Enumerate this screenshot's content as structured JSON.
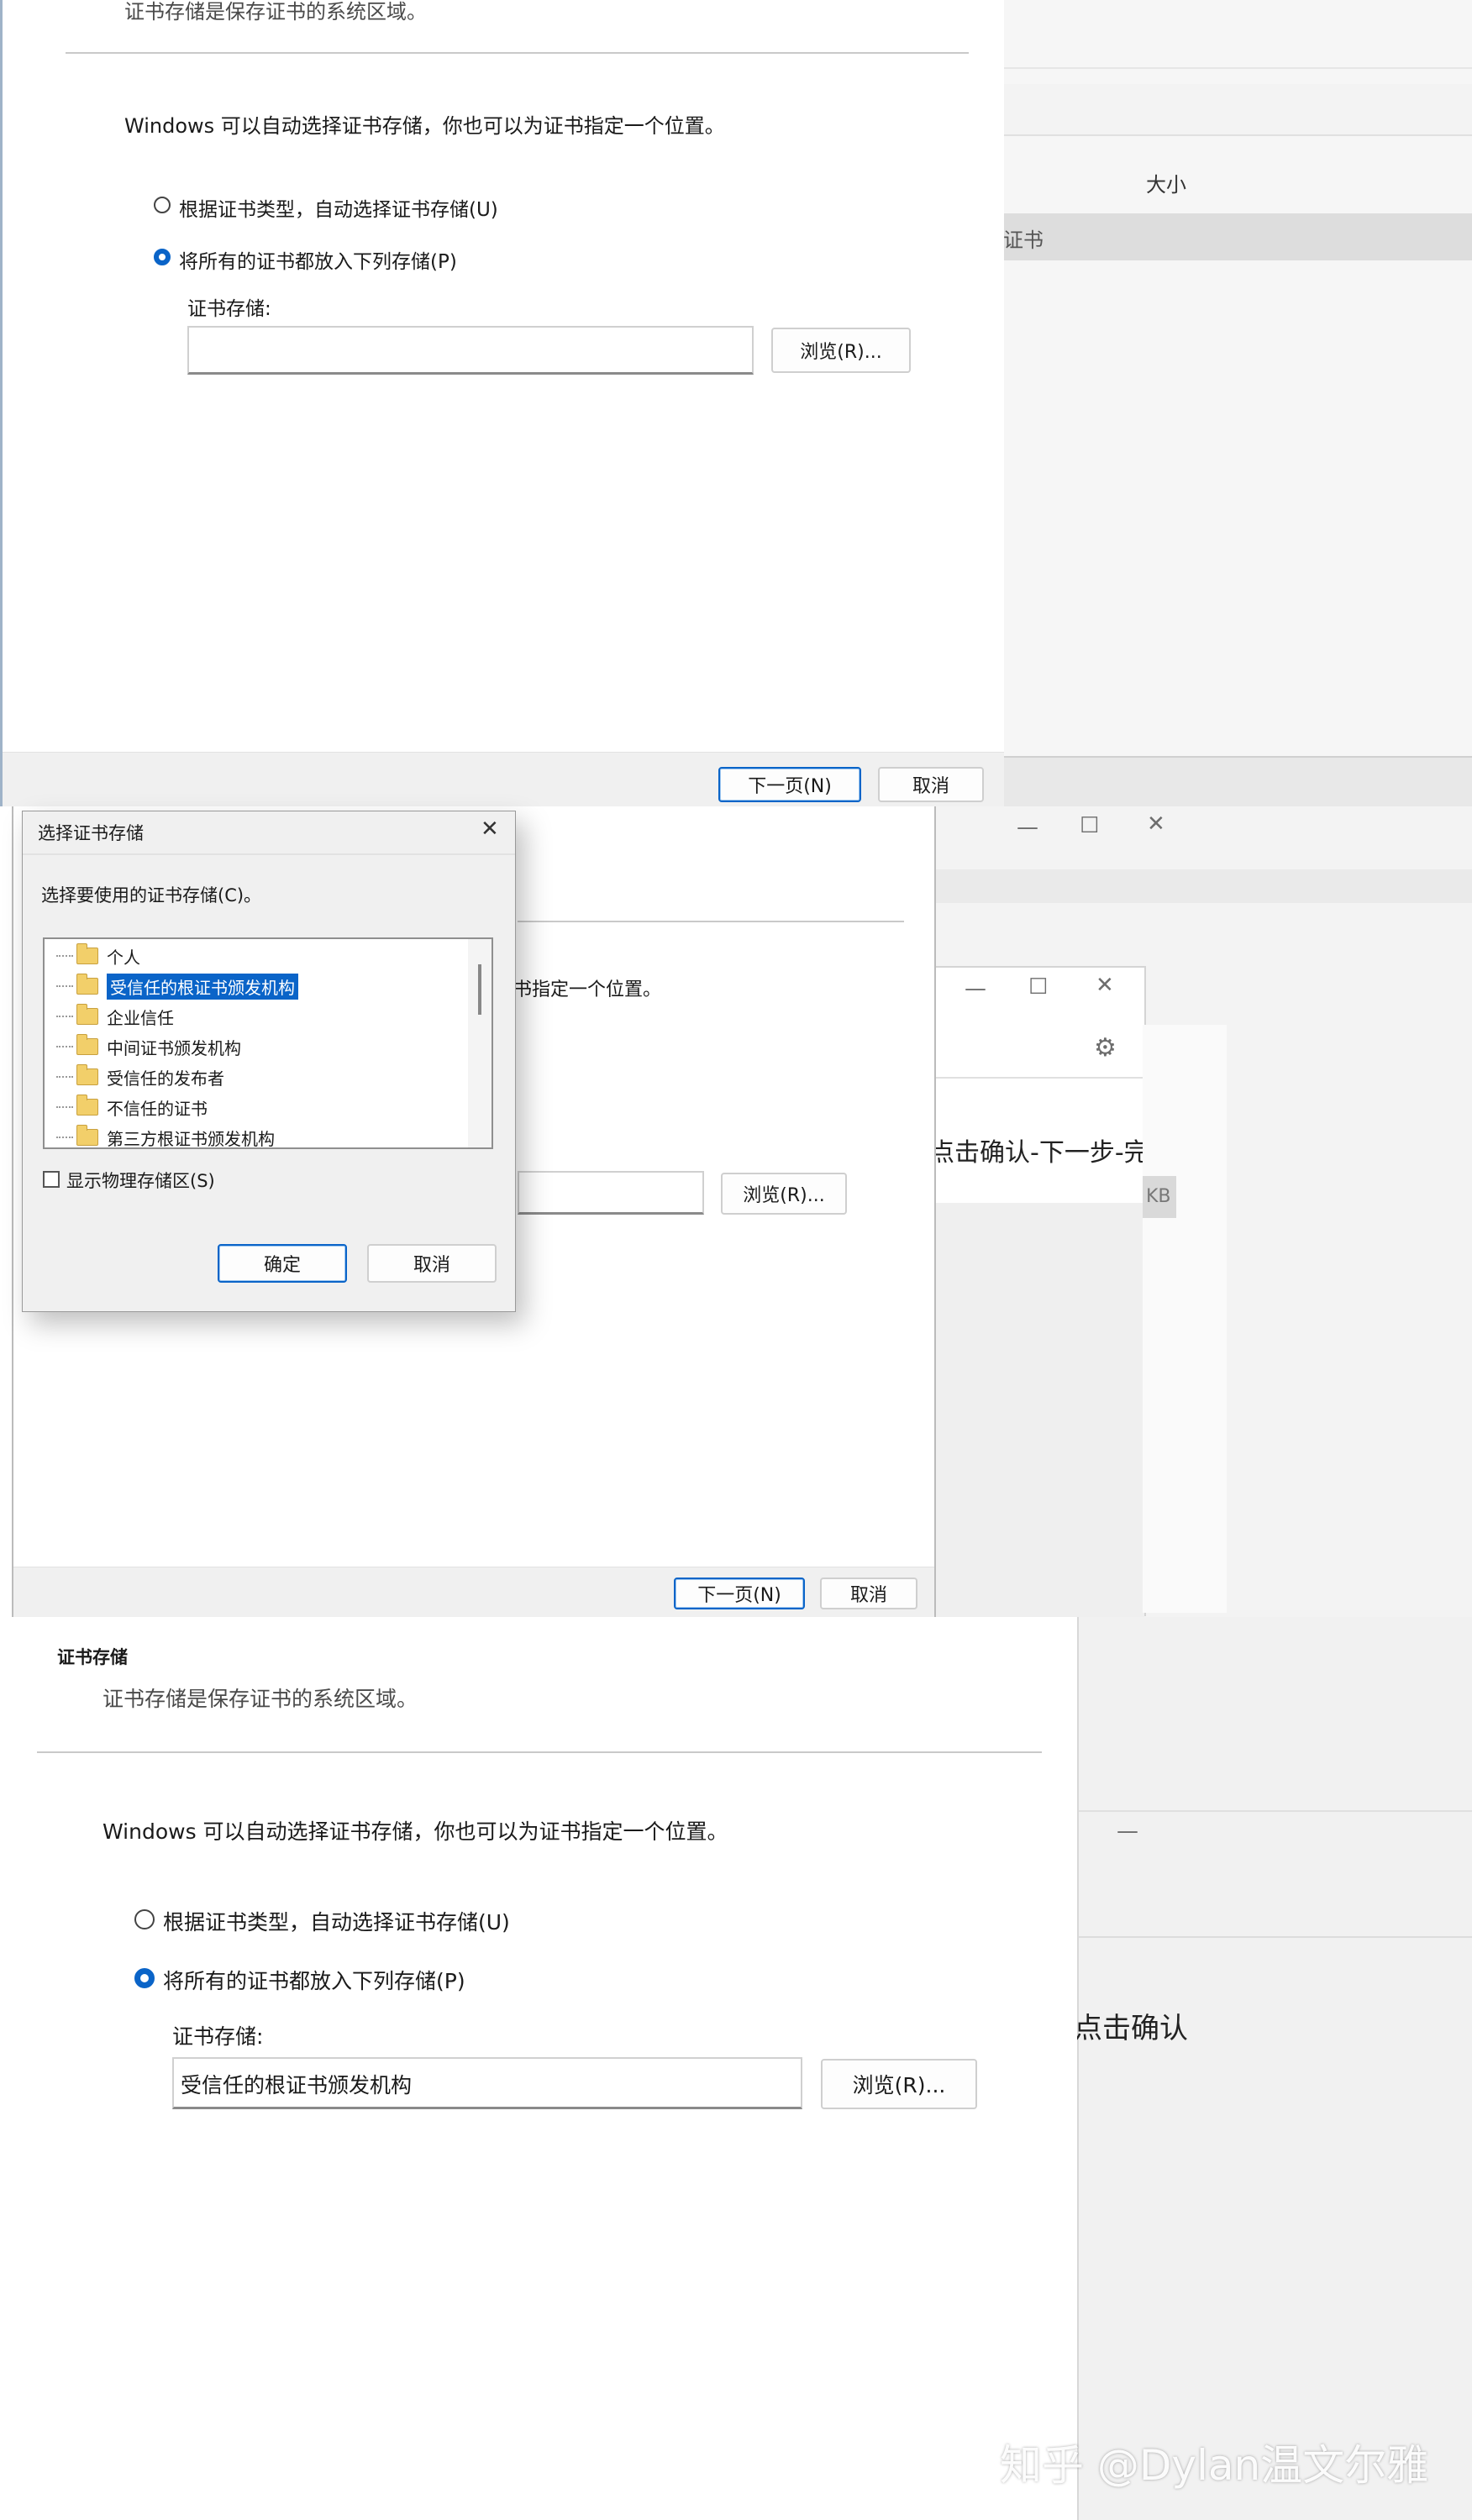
{
  "panel1": {
    "header_desc": "证书存储是保存证书的系统区域。",
    "intro": "Windows 可以自动选择证书存储，你也可以为证书指定一个位置。",
    "radio_auto": "根据证书类型，自动选择证书存储(U)",
    "radio_manual": "将所有的证书都放入下列存储(P)",
    "store_label": "证书存储:",
    "store_value": "",
    "browse": "浏览(R)...",
    "next": "下一页(N)",
    "cancel": "取消"
  },
  "panel1_right": {
    "col_header": "大小",
    "row_text": "证书"
  },
  "panel2": {
    "intro_partial": "书指定一个位置。",
    "browse": "浏览(R)...",
    "next": "下一页(N)",
    "cancel": "取消",
    "right_text": "点击确认-下一步-完成",
    "kb": "KB"
  },
  "select_dialog": {
    "title": "选择证书存储",
    "prompt": "选择要使用的证书存储(C)。",
    "items": [
      "个人",
      "受信任的根证书颁发机构",
      "企业信任",
      "中间证书颁发机构",
      "受信任的发布者",
      "不信任的证书",
      "第三方根证书颁发机构"
    ],
    "selected_index": 1,
    "show_physical": "显示物理存储区(S)",
    "ok": "确定",
    "cancel": "取消"
  },
  "panel3": {
    "section_title": "证书存储",
    "header_desc": "证书存储是保存证书的系统区域。",
    "intro": "Windows 可以自动选择证书存储，你也可以为证书指定一个位置。",
    "radio_auto": "根据证书类型，自动选择证书存储(U)",
    "radio_manual": "将所有的证书都放入下列存储(P)",
    "store_label": "证书存储:",
    "store_value": "受信任的根证书颁发机构",
    "browse": "浏览(R)...",
    "right_text": "点击确认"
  },
  "watermark": "知乎 @Dylan温文尔雅"
}
